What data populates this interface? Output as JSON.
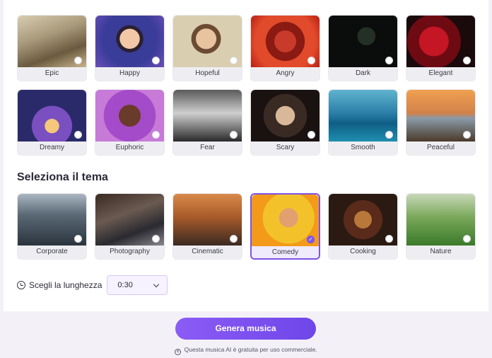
{
  "moods_row1": [
    "Epic",
    "Happy",
    "Hopeful",
    "Angry",
    "Dark",
    "Elegant"
  ],
  "moods_row2": [
    "Dreamy",
    "Euphoric",
    "Fear",
    "Scary",
    "Smooth",
    "Peaceful"
  ],
  "theme_section": {
    "title": "Seleziona il tema",
    "themes": [
      "Corporate",
      "Photography",
      "Cinematic",
      "Comedy",
      "Cooking",
      "Nature"
    ],
    "selected": "Comedy"
  },
  "length": {
    "label": "Scegli la lunghezza",
    "value": "0:30"
  },
  "generate_label": "Genera musica",
  "footnote": "Questa musica AI è gratuita per uso commerciale.",
  "icons": {
    "card_radio": "radio-circle-icon",
    "selected_check": "checkmark-icon",
    "length": "clock-icon",
    "select": "chevron-down-icon",
    "footnote": "copyright-icon"
  },
  "colors": {
    "accent": "#7c54e6",
    "card_bg": "#eeeef2"
  }
}
